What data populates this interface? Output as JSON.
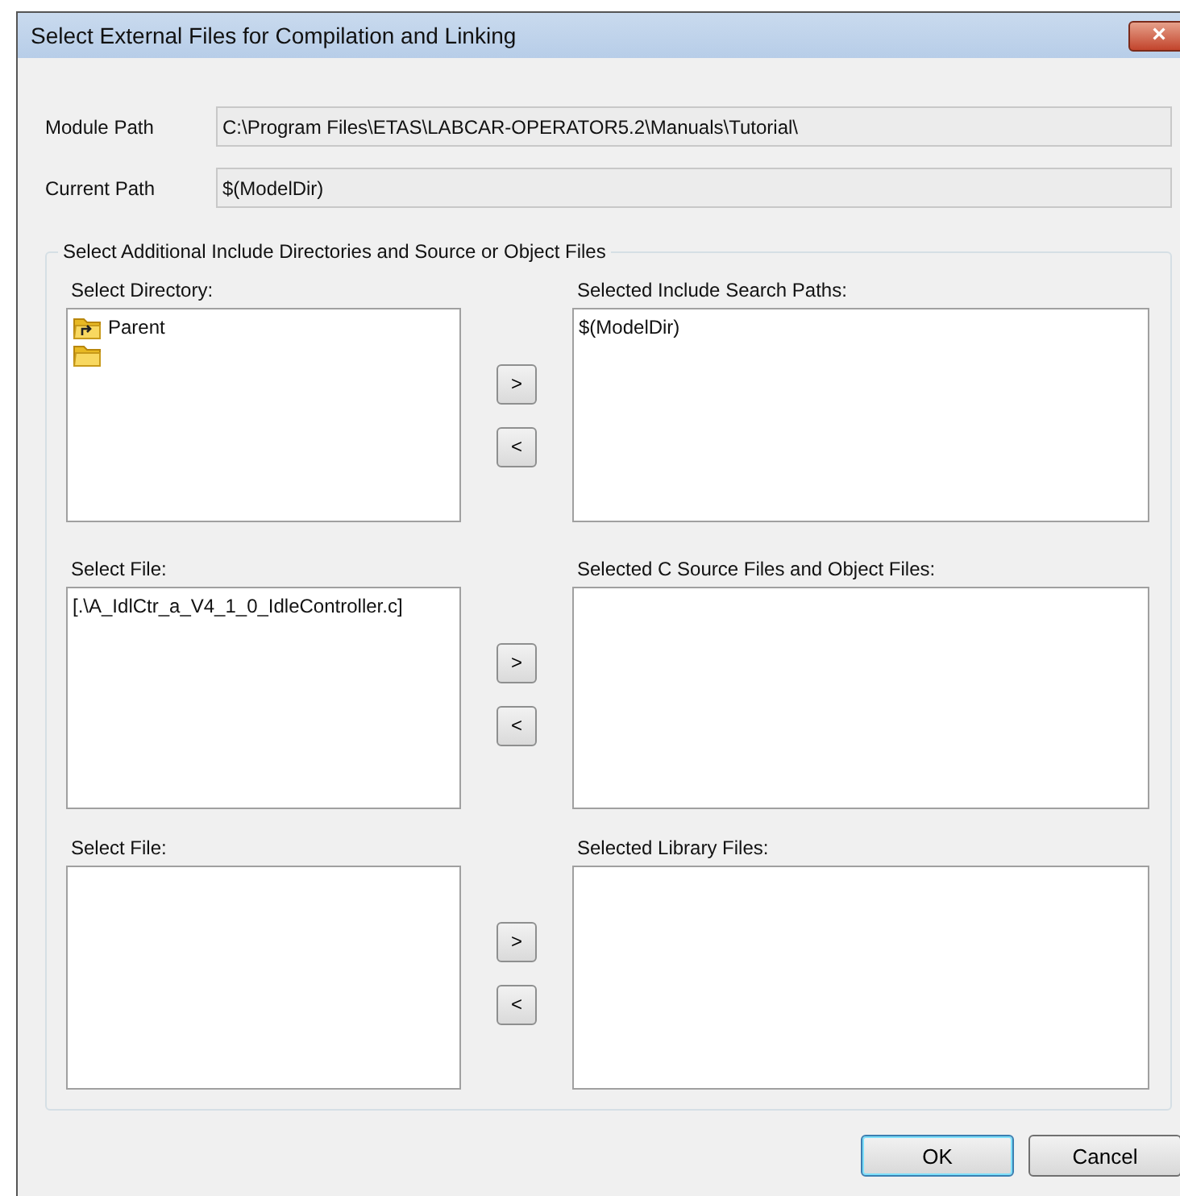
{
  "window": {
    "title": "Select External Files for Compilation and Linking",
    "close_button": "×"
  },
  "paths": [
    {
      "label": "Module Path",
      "value": "C:\\Program Files\\ETAS\\LABCAR-OPERATOR5.2\\Manuals\\Tutorial\\"
    },
    {
      "label": "Current Path",
      "value": "$(ModelDir)"
    }
  ],
  "group": {
    "title": "Select Additional Include Directories and Source or Object Files",
    "sections": [
      {
        "left_label": "Select Directory:",
        "left_items": [
          {
            "kind": "parent",
            "text": "Parent"
          },
          {
            "kind": "folder"
          }
        ],
        "add_button": ">",
        "remove_button": "<",
        "right_label": "Selected Include Search Paths:",
        "right_items": [
          "$(ModelDir)"
        ]
      },
      {
        "left_label": "Select File:",
        "left_items": [
          {
            "kind": "file",
            "text": "[.\\A_IdlCtr_a_V4_1_0_IdleController.c]"
          }
        ],
        "add_button": ">",
        "remove_button": "<",
        "right_label": "Selected C Source Files and Object Files:"
      },
      {
        "left_label": "Select File:",
        "add_button": ">",
        "remove_button": "<",
        "right_label": "Selected Library Files:"
      }
    ]
  },
  "buttons": [
    {
      "label": "OK",
      "default": true
    },
    {
      "label": "Cancel",
      "default": false
    }
  ]
}
